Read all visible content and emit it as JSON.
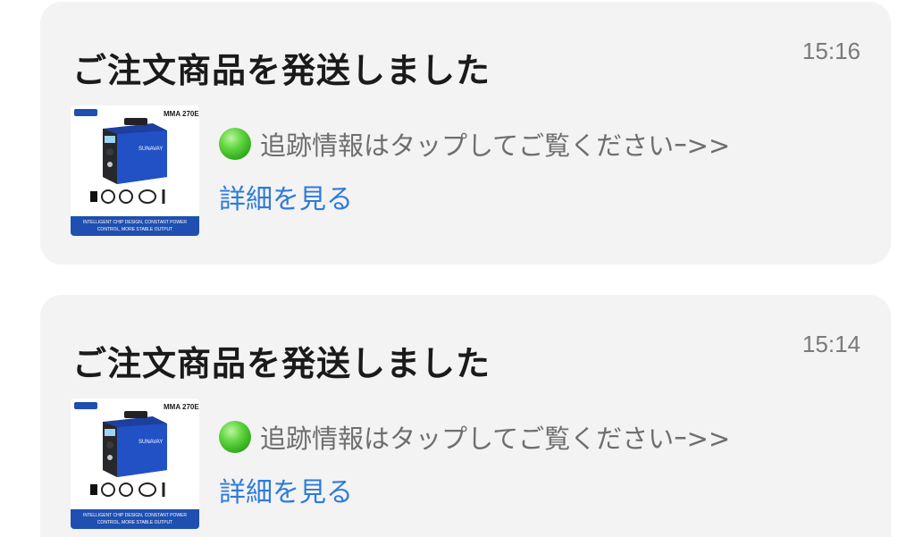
{
  "notifications": [
    {
      "title": "ご注文商品を発送しました",
      "time": "15:16",
      "message": "追跡情報はタップしてご覧くださいｰ>>",
      "details_label": "詳細を見る",
      "product_image": {
        "model": "MMA 270E",
        "caption_line1": "INTELLIGENT CHIP DESIGN, CONSTANT POWER",
        "caption_line2": "CONTROL, MORE STABLE OUTPUT"
      }
    },
    {
      "title": "ご注文商品を発送しました",
      "time": "15:14",
      "message": "追跡情報はタップしてご覧くださいｰ>>",
      "details_label": "詳細を見る",
      "product_image": {
        "model": "MMA 270E",
        "caption_line1": "INTELLIGENT CHIP DESIGN, CONSTANT POWER",
        "caption_line2": "CONTROL, MORE STABLE OUTPUT"
      }
    }
  ],
  "colors": {
    "card_background": "#f3f3f3",
    "link": "#2f7bd8",
    "status_dot": "#3fbf2a",
    "product_blue": "#1f4fb0"
  }
}
